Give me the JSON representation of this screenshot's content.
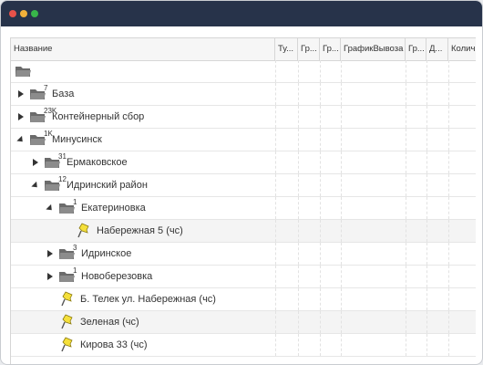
{
  "window": {
    "controls": [
      "close",
      "minimize",
      "maximize"
    ]
  },
  "columns": [
    "Название",
    "Ту...",
    "Гр...",
    "Гр...",
    "ГрафикВывоза",
    "Гр...",
    "Д...",
    "Колич"
  ],
  "rows": [
    {
      "label": "",
      "level": 0,
      "expander": "none",
      "icon": "folder-open-icon",
      "badge": ""
    },
    {
      "label": "База",
      "level": 0,
      "expander": "collapsed",
      "icon": "folder-icon",
      "badge": "7"
    },
    {
      "label": "Контейнерный сбор",
      "level": 0,
      "expander": "collapsed",
      "icon": "folder-icon",
      "badge": "23K"
    },
    {
      "label": "Минусинск",
      "level": 0,
      "expander": "expanded",
      "icon": "folder-icon",
      "badge": "1K"
    },
    {
      "label": "Ермаковское",
      "level": 1,
      "expander": "collapsed",
      "icon": "folder-icon",
      "badge": "31"
    },
    {
      "label": "Идринский район",
      "level": 1,
      "expander": "expanded",
      "icon": "folder-icon",
      "badge": "12"
    },
    {
      "label": "Екатериновка",
      "level": 2,
      "expander": "expanded",
      "icon": "folder-icon",
      "badge": "1"
    },
    {
      "label": "Набережная 5 (чс)",
      "level": 3,
      "expander": "none",
      "icon": "pushpin-icon",
      "badge": ""
    },
    {
      "label": "Идринское",
      "level": 2,
      "expander": "collapsed",
      "icon": "folder-icon",
      "badge": "3"
    },
    {
      "label": "Новоберезовка",
      "level": 2,
      "expander": "collapsed",
      "icon": "folder-icon",
      "badge": "1"
    },
    {
      "label": "Б. Телек ул. Набережная (чс)",
      "level": 2,
      "expander": "none",
      "icon": "pushpin-icon",
      "badge": ""
    },
    {
      "label": "Зеленая (чс)",
      "level": 2,
      "expander": "none",
      "icon": "pushpin-icon",
      "badge": ""
    },
    {
      "label": "Кирова 33 (чс)",
      "level": 2,
      "expander": "none",
      "icon": "pushpin-icon",
      "badge": ""
    }
  ],
  "colors": {
    "titlebar": "#27334a",
    "folder": "#6b6b6b",
    "pin": "#f5e03a",
    "selected_row": "#f4f4f4"
  }
}
